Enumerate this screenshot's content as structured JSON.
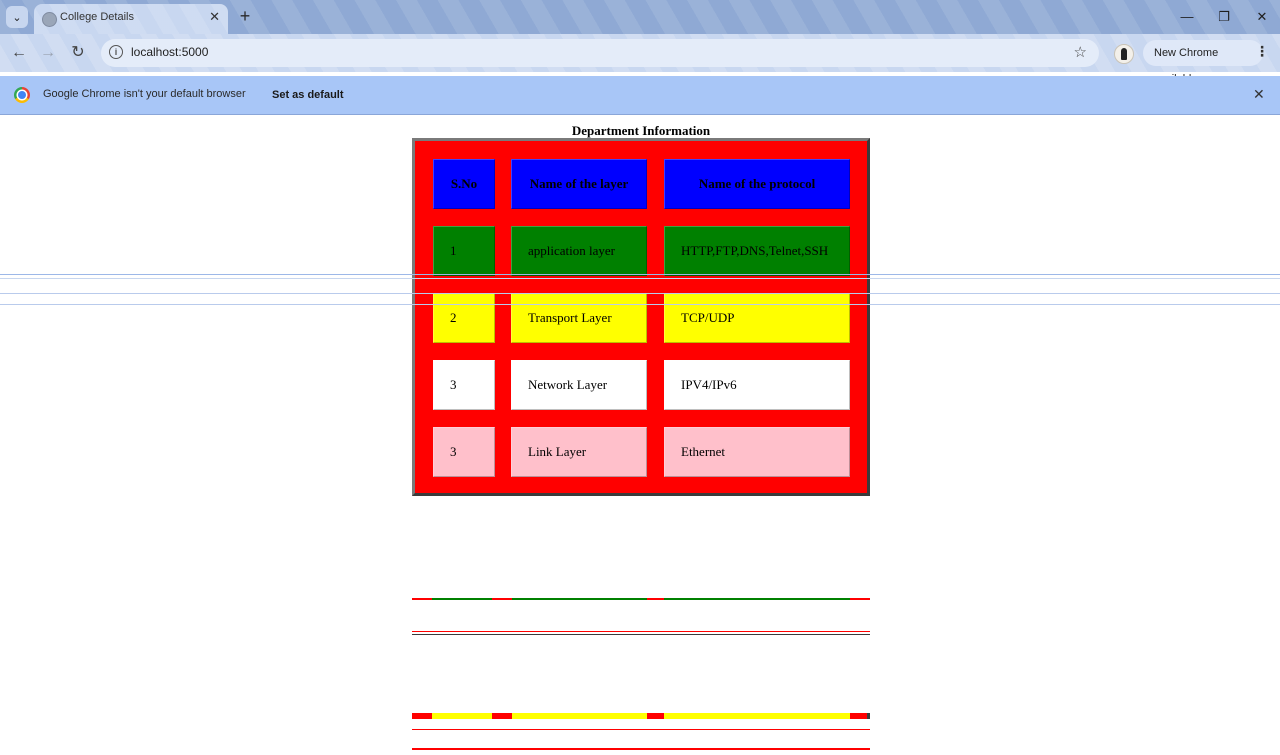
{
  "browser": {
    "tab_title": "College Details",
    "url": "localhost:5000",
    "update_chip": "New Chrome available",
    "infobar_message": "Google Chrome isn't your default browser",
    "infobar_button": "Set as default"
  },
  "page": {
    "title": "Department Information",
    "table": {
      "headers": [
        "S.No",
        "Name of the layer",
        "Name of the protocol"
      ],
      "rows": [
        {
          "sno": "1",
          "layer": "application layer",
          "protocol": "HTTP,FTP,DNS,Telnet,SSH",
          "color": "#008000"
        },
        {
          "sno": "2",
          "layer": "Transport Layer",
          "protocol": "TCP/UDP",
          "color": "#ffff00"
        },
        {
          "sno": "3",
          "layer": "Network Layer",
          "protocol": "IPV4/IPv6",
          "color": "#ffffff"
        },
        {
          "sno": "3",
          "layer": "Link Layer",
          "protocol": "Ethernet",
          "color": "#ffc0cb"
        }
      ],
      "header_color": "#0000ff",
      "background_color": "#ff0000"
    }
  },
  "icons": {
    "tab_search": "chevron-down-icon",
    "favicon": "globe-icon",
    "tab_close": "close-icon",
    "new_tab": "plus-icon",
    "back": "arrow-left-icon",
    "forward": "arrow-right-icon",
    "reload": "reload-icon",
    "site_info": "info-icon",
    "bookmark": "star-icon",
    "menu": "kebab-icon"
  }
}
